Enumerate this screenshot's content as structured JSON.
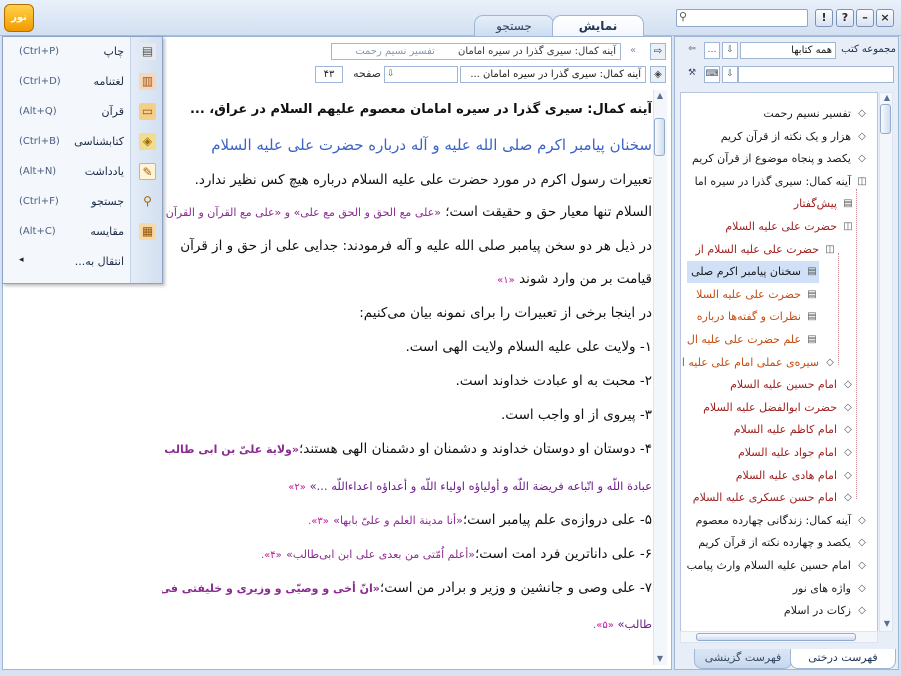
{
  "app": {
    "logo": "نور",
    "tabs": {
      "display": "نمایش",
      "search": "جستجو"
    },
    "window_buttons": {
      "help": "?",
      "alert": "!",
      "minimize": "–",
      "close": "×"
    }
  },
  "menu": {
    "items": [
      {
        "label": "چاپ",
        "shortcut": "(Ctrl+P)",
        "icon": "printer-icon",
        "glyph": "▤"
      },
      {
        "label": "لغتنامه",
        "shortcut": "(Ctrl+D)",
        "icon": "dictionary-icon",
        "glyph": "▥"
      },
      {
        "label": "قرآن",
        "shortcut": "(Alt+Q)",
        "icon": "quran-icon",
        "glyph": "▭"
      },
      {
        "label": "کتابشناسی",
        "shortcut": "(Ctrl+B)",
        "icon": "bibliography-icon",
        "glyph": "◈"
      },
      {
        "label": "یادداشت",
        "shortcut": "(Alt+N)",
        "icon": "note-icon",
        "glyph": "✎"
      },
      {
        "label": "جستجو",
        "shortcut": "(Ctrl+F)",
        "icon": "search-icon",
        "glyph": "⚲"
      },
      {
        "label": "مقایسه",
        "shortcut": "(Alt+C)",
        "icon": "compare-icon",
        "glyph": "▦"
      }
    ],
    "more_label": "انتقال به..."
  },
  "toolbar": {
    "path_placeholder": "تفسیر نسیم رحمت",
    "path_value": "آینه کمال: سیری گذرا در سیره امامان",
    "location_value": "آینه کمال: سیری گذرا در سیره امامان ...",
    "page_label": "صفحه",
    "page_number": "۴۳"
  },
  "reader": {
    "heading": "آینه کمال: سیری گذرا در سیره امامان معصوم علیهم السلام در عراق، ...",
    "section_title": "سخنان پیامبر اکرم صلی الله علیه و آله درباره حضرت علی علیه السلام",
    "p1": "تعبیرات رسول اکرم در مورد حضرت علی علیه السلام درباره هیچ کس نظیر ندارد.",
    "p2_text": "السلام تنها معیار حق و حقیقت است؛",
    "p2_quote": "«علی مع الحق و الحق مع علی» و «علی مع القرآن و القرآن مع علی»",
    "p3": "در ذیل هر دو سخن پیامبر صلی الله علیه و آله فرمودند: جدایی علی از حق و از قرآن",
    "p4_text": "قیامت بر من وارد شوند",
    "p4_ref": "«۱»",
    "p5": "در اینجا برخی از تعبیرات را برای نمونه بیان می‌کنیم:",
    "l1": "۱- ولایت علی علیه السلام ولایت الهی است.",
    "l2": "۲- محبت به او عبادت خداوند است.",
    "l3": "۳- پیروی از او واجب است.",
    "l4_text": "۴- دوستان او دوستان خداوند و دشمنان او دشمنان الهی هستند؛",
    "l4_quote": "«ولایة علیّ بن ابی طالب ولایة اللّه و حبّه",
    "l4b_quote": "عبادة اللّه و اتّباعه فریضة اللّه و أولیاؤه اولیاء اللّه و أعداؤه اعداءاللّه ...»",
    "l4b_ref": "«۲»",
    "l5_text": "۵- علی دروازه‌ی علم پیامبر است؛",
    "l5_quote": "«أنا مدینة العلم و علیّ بابها»",
    "l5_ref": "«۳».",
    "l6_text": "۶- علی داناترین فرد امت است؛",
    "l6_quote": "«أعلم اُمّتی من بعدی علی ابن ابی‌طالب»",
    "l6_ref": "«۴».",
    "l7_text": "۷- علی وصی و جانشین و وزیر و برادر من است؛",
    "l7_quote": "«انّ أخی و وصیّی و وزیری و خلیفتی فی أهلی علی ابن أبی",
    "l8_quote": "طالب»",
    "l8_ref": "«۵»."
  },
  "panel": {
    "title": "مجموعه کتب",
    "combo_value": "همه کتابها",
    "tree": [
      {
        "label": "تفسیر نسیم رحمت",
        "icon": "book-icon",
        "glyph": "◇",
        "style": "",
        "depth": 0
      },
      {
        "label": "هزار و یک نکته از قرآن کریم",
        "icon": "book-icon",
        "glyph": "◇",
        "style": "",
        "depth": 0
      },
      {
        "label": "یکصد و پنجاه موضوع از قرآن کریم",
        "icon": "book-icon",
        "glyph": "◇",
        "style": "",
        "depth": 0
      },
      {
        "label": "آینه کمال: سیری گذرا در سیره اما",
        "icon": "open-book-icon",
        "glyph": "◫",
        "style": "",
        "depth": 0
      },
      {
        "label": "پیش‌گفتار",
        "icon": "page-icon",
        "glyph": "▤",
        "style": "red",
        "depth": 1
      },
      {
        "label": "حضرت علی علیه السلام",
        "icon": "open-book-icon",
        "glyph": "◫",
        "style": "red",
        "depth": 1
      },
      {
        "label": "حضرت علی علیه السلام از",
        "icon": "open-book-icon",
        "glyph": "◫",
        "style": "red",
        "depth": 2
      },
      {
        "label": "سخنان پیامبر اکرم صلی",
        "icon": "page-icon",
        "glyph": "▤",
        "style": "sel",
        "depth": 3
      },
      {
        "label": "حضرت علی علیه السلا",
        "icon": "page-icon",
        "glyph": "▤",
        "style": "orange",
        "depth": 3
      },
      {
        "label": "نظرات و گفته‌ها درباره",
        "icon": "page-icon",
        "glyph": "▤",
        "style": "orange",
        "depth": 3
      },
      {
        "label": "علم حضرت علی علیه ال",
        "icon": "page-icon",
        "glyph": "▤",
        "style": "orange",
        "depth": 3
      },
      {
        "label": "سیره‌ی عملی امام علی علیه ا",
        "icon": "book-icon",
        "glyph": "◇",
        "style": "orange",
        "depth": 2
      },
      {
        "label": "امام حسین علیه السلام",
        "icon": "book-icon",
        "glyph": "◇",
        "style": "red",
        "depth": 1
      },
      {
        "label": "حضرت ابوالفضل علیه السلام",
        "icon": "book-icon",
        "glyph": "◇",
        "style": "red",
        "depth": 1
      },
      {
        "label": "امام کاظم علیه السلام",
        "icon": "book-icon",
        "glyph": "◇",
        "style": "red",
        "depth": 1
      },
      {
        "label": "امام جواد علیه السلام",
        "icon": "book-icon",
        "glyph": "◇",
        "style": "red",
        "depth": 1
      },
      {
        "label": "امام هادی علیه السلام",
        "icon": "book-icon",
        "glyph": "◇",
        "style": "red",
        "depth": 1
      },
      {
        "label": "امام حسن عسکری علیه السلام",
        "icon": "book-icon",
        "glyph": "◇",
        "style": "red",
        "depth": 1
      },
      {
        "label": "آینه کمال: زندگانی چهارده معصوم",
        "icon": "book-icon",
        "glyph": "◇",
        "style": "",
        "depth": 0
      },
      {
        "label": "یکصد و چهارده نکته از قرآن کریم",
        "icon": "book-icon",
        "glyph": "◇",
        "style": "",
        "depth": 0
      },
      {
        "label": "امام حسین علیه السلام وارث پیامب",
        "icon": "book-icon",
        "glyph": "◇",
        "style": "",
        "depth": 0
      },
      {
        "label": "واژه های نور",
        "icon": "book-icon",
        "glyph": "◇",
        "style": "",
        "depth": 0
      },
      {
        "label": "زکات در اسلام",
        "icon": "book-icon",
        "glyph": "◇",
        "style": "",
        "depth": 0
      }
    ],
    "bottom_tabs": {
      "tree": "فهرست درختی",
      "select": "فهرست گزینشی"
    }
  },
  "colors": {
    "accent": "#3b63c6",
    "quote": "#8a2b8f",
    "reference": "#c0169a",
    "tree_red": "#a02020",
    "tree_orange": "#c24d10",
    "selection": "#cfe0f7"
  }
}
